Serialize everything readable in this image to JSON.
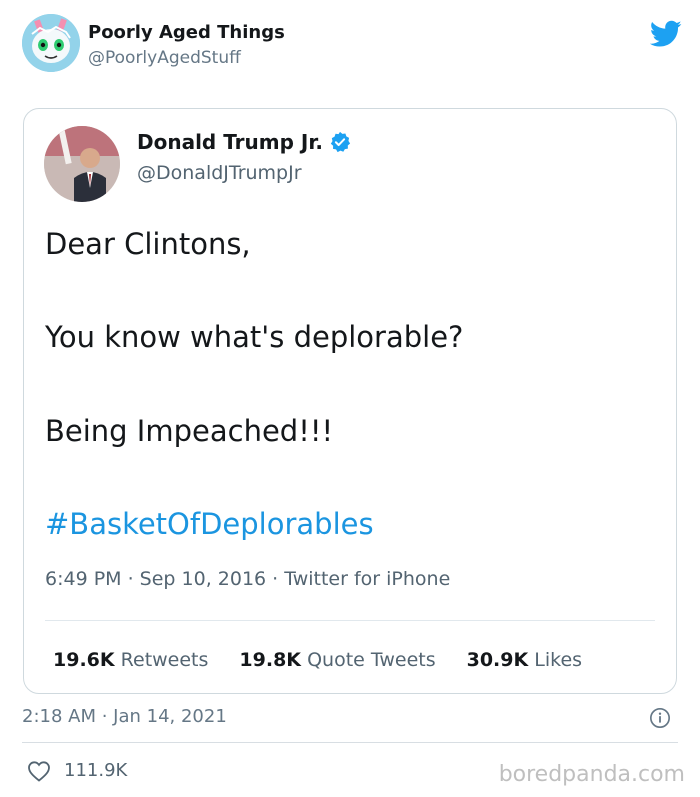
{
  "outer_tweet": {
    "author_name": "Poorly Aged Things",
    "author_handle": "@PoorlyAgedStuff",
    "timestamp": "2:18 AM · Jan 14, 2021",
    "likes": "111.9K"
  },
  "quoted_tweet": {
    "author_name": "Donald Trump Jr.",
    "author_handle": "@DonaldJTrumpJr",
    "lines": [
      "Dear Clintons,",
      "You know what's deplorable?",
      "Being Impeached!!!"
    ],
    "hashtag": "#BasketOfDeplorables",
    "meta": "6:49 PM · Sep 10, 2016 · Twitter for iPhone",
    "stats": [
      {
        "value": "19.6K",
        "label": "Retweets"
      },
      {
        "value": "19.8K",
        "label": "Quote Tweets"
      },
      {
        "value": "30.9K",
        "label": "Likes"
      }
    ]
  },
  "watermark": "boredpanda.com",
  "colors": {
    "twitter_blue": "#1da1f2",
    "hashtag": "#1b95e0",
    "muted_text": "#536471"
  },
  "icons": [
    "twitter-bird-icon",
    "verified-badge-icon",
    "info-icon",
    "heart-icon"
  ]
}
